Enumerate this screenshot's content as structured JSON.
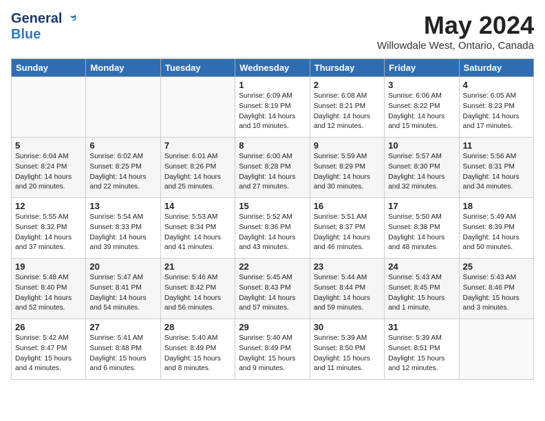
{
  "header": {
    "logo_general": "General",
    "logo_blue": "Blue",
    "month_title": "May 2024",
    "location": "Willowdale West, Ontario, Canada"
  },
  "days_of_week": [
    "Sunday",
    "Monday",
    "Tuesday",
    "Wednesday",
    "Thursday",
    "Friday",
    "Saturday"
  ],
  "weeks": [
    [
      {
        "day": "",
        "info": ""
      },
      {
        "day": "",
        "info": ""
      },
      {
        "day": "",
        "info": ""
      },
      {
        "day": "1",
        "info": "Sunrise: 6:09 AM\nSunset: 8:19 PM\nDaylight: 14 hours\nand 10 minutes."
      },
      {
        "day": "2",
        "info": "Sunrise: 6:08 AM\nSunset: 8:21 PM\nDaylight: 14 hours\nand 12 minutes."
      },
      {
        "day": "3",
        "info": "Sunrise: 6:06 AM\nSunset: 8:22 PM\nDaylight: 14 hours\nand 15 minutes."
      },
      {
        "day": "4",
        "info": "Sunrise: 6:05 AM\nSunset: 8:23 PM\nDaylight: 14 hours\nand 17 minutes."
      }
    ],
    [
      {
        "day": "5",
        "info": "Sunrise: 6:04 AM\nSunset: 8:24 PM\nDaylight: 14 hours\nand 20 minutes."
      },
      {
        "day": "6",
        "info": "Sunrise: 6:02 AM\nSunset: 8:25 PM\nDaylight: 14 hours\nand 22 minutes."
      },
      {
        "day": "7",
        "info": "Sunrise: 6:01 AM\nSunset: 8:26 PM\nDaylight: 14 hours\nand 25 minutes."
      },
      {
        "day": "8",
        "info": "Sunrise: 6:00 AM\nSunset: 8:28 PM\nDaylight: 14 hours\nand 27 minutes."
      },
      {
        "day": "9",
        "info": "Sunrise: 5:59 AM\nSunset: 8:29 PM\nDaylight: 14 hours\nand 30 minutes."
      },
      {
        "day": "10",
        "info": "Sunrise: 5:57 AM\nSunset: 8:30 PM\nDaylight: 14 hours\nand 32 minutes."
      },
      {
        "day": "11",
        "info": "Sunrise: 5:56 AM\nSunset: 8:31 PM\nDaylight: 14 hours\nand 34 minutes."
      }
    ],
    [
      {
        "day": "12",
        "info": "Sunrise: 5:55 AM\nSunset: 8:32 PM\nDaylight: 14 hours\nand 37 minutes."
      },
      {
        "day": "13",
        "info": "Sunrise: 5:54 AM\nSunset: 8:33 PM\nDaylight: 14 hours\nand 39 minutes."
      },
      {
        "day": "14",
        "info": "Sunrise: 5:53 AM\nSunset: 8:34 PM\nDaylight: 14 hours\nand 41 minutes."
      },
      {
        "day": "15",
        "info": "Sunrise: 5:52 AM\nSunset: 8:36 PM\nDaylight: 14 hours\nand 43 minutes."
      },
      {
        "day": "16",
        "info": "Sunrise: 5:51 AM\nSunset: 8:37 PM\nDaylight: 14 hours\nand 46 minutes."
      },
      {
        "day": "17",
        "info": "Sunrise: 5:50 AM\nSunset: 8:38 PM\nDaylight: 14 hours\nand 48 minutes."
      },
      {
        "day": "18",
        "info": "Sunrise: 5:49 AM\nSunset: 8:39 PM\nDaylight: 14 hours\nand 50 minutes."
      }
    ],
    [
      {
        "day": "19",
        "info": "Sunrise: 5:48 AM\nSunset: 8:40 PM\nDaylight: 14 hours\nand 52 minutes."
      },
      {
        "day": "20",
        "info": "Sunrise: 5:47 AM\nSunset: 8:41 PM\nDaylight: 14 hours\nand 54 minutes."
      },
      {
        "day": "21",
        "info": "Sunrise: 5:46 AM\nSunset: 8:42 PM\nDaylight: 14 hours\nand 56 minutes."
      },
      {
        "day": "22",
        "info": "Sunrise: 5:45 AM\nSunset: 8:43 PM\nDaylight: 14 hours\nand 57 minutes."
      },
      {
        "day": "23",
        "info": "Sunrise: 5:44 AM\nSunset: 8:44 PM\nDaylight: 14 hours\nand 59 minutes."
      },
      {
        "day": "24",
        "info": "Sunrise: 5:43 AM\nSunset: 8:45 PM\nDaylight: 15 hours\nand 1 minute."
      },
      {
        "day": "25",
        "info": "Sunrise: 5:43 AM\nSunset: 8:46 PM\nDaylight: 15 hours\nand 3 minutes."
      }
    ],
    [
      {
        "day": "26",
        "info": "Sunrise: 5:42 AM\nSunset: 8:47 PM\nDaylight: 15 hours\nand 4 minutes."
      },
      {
        "day": "27",
        "info": "Sunrise: 5:41 AM\nSunset: 8:48 PM\nDaylight: 15 hours\nand 6 minutes."
      },
      {
        "day": "28",
        "info": "Sunrise: 5:40 AM\nSunset: 8:49 PM\nDaylight: 15 hours\nand 8 minutes."
      },
      {
        "day": "29",
        "info": "Sunrise: 5:40 AM\nSunset: 8:49 PM\nDaylight: 15 hours\nand 9 minutes."
      },
      {
        "day": "30",
        "info": "Sunrise: 5:39 AM\nSunset: 8:50 PM\nDaylight: 15 hours\nand 11 minutes."
      },
      {
        "day": "31",
        "info": "Sunrise: 5:39 AM\nSunset: 8:51 PM\nDaylight: 15 hours\nand 12 minutes."
      },
      {
        "day": "",
        "info": ""
      }
    ]
  ]
}
